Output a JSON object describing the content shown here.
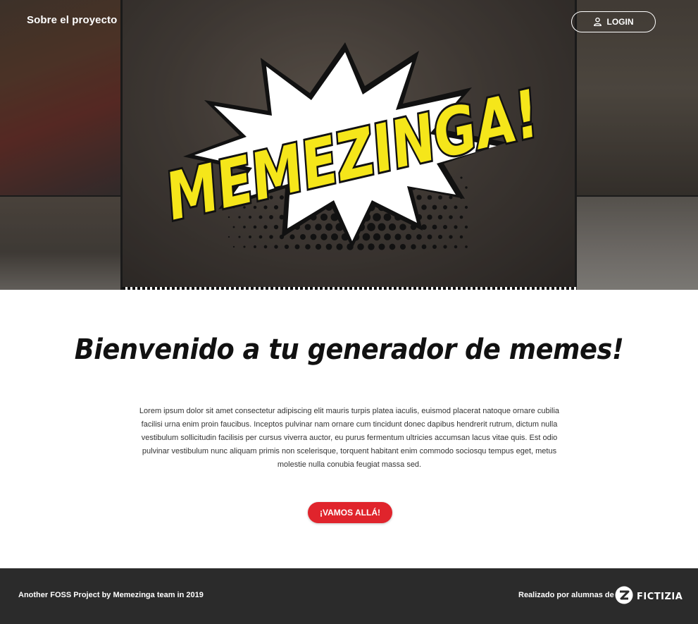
{
  "nav": {
    "about_label": "Sobre el proyecto",
    "login_label": "LOGIN",
    "login_icon": "user-icon"
  },
  "hero": {
    "logo_text": "MEMEZINGA!",
    "colors": {
      "logo_fill": "#f5e61a",
      "logo_outline": "#111111",
      "burst_fill": "#ffffff"
    }
  },
  "main": {
    "welcome_heading": "Bienvenido a tu generador de memes!",
    "intro_text": "Lorem ipsum dolor sit amet consectetur adipiscing elit mauris turpis platea iaculis, euismod placerat natoque ornare cubilia facilisi urna enim proin faucibus. Inceptos pulvinar nam ornare cum tincidunt donec dapibus hendrerit rutrum, dictum nulla vestibulum sollicitudin facilisis per cursus viverra auctor, eu purus fermentum ultricies accumsan lacus vitae quis. Est odio pulvinar vestibulum nunc aliquam primis non scelerisque, torquent habitant enim commodo sociosqu tempus eget, metus molestie nulla conubia feugiat massa sed.",
    "cta_label": "¡VAMOS ALLÁ!",
    "colors": {
      "cta_bg": "#e0242c"
    }
  },
  "footer": {
    "left_text": "Another FOSS Project by Memezinga team in 2019",
    "right_text": "Realizado por alumnas de",
    "brand_name": "FICTIZIA",
    "brand_icon": "fictizia-logo-icon",
    "colors": {
      "bg": "#2b2b2b"
    }
  }
}
